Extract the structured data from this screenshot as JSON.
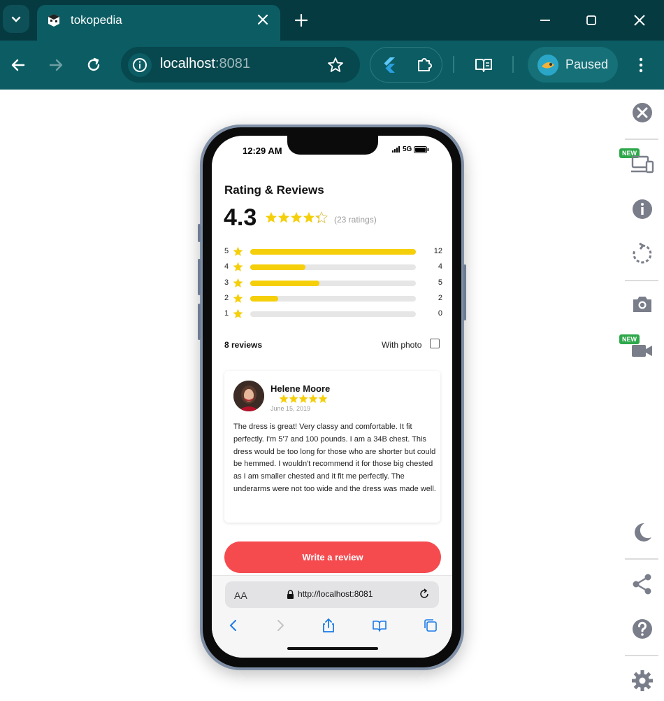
{
  "browser": {
    "tab_title": "tokopedia",
    "url_host": "localhost",
    "url_port": ":8081",
    "profile_label": "Paused"
  },
  "side_panel": {
    "new_badge_1": "NEW",
    "new_badge_2": "NEW"
  },
  "phone": {
    "status_time": "12:29 AM",
    "status_network": "5G",
    "title": "Rating & Reviews",
    "average": "4.3",
    "ratings_count": "(23 ratings)",
    "distribution": [
      {
        "stars": "5",
        "count": "12",
        "fraction": 1.0
      },
      {
        "stars": "4",
        "count": "4",
        "fraction": 0.333
      },
      {
        "stars": "3",
        "count": "5",
        "fraction": 0.417
      },
      {
        "stars": "2",
        "count": "2",
        "fraction": 0.167
      },
      {
        "stars": "1",
        "count": "0",
        "fraction": 0.0
      }
    ],
    "reviews_count": "8 reviews",
    "with_photo_label": "With photo",
    "review": {
      "name": "Helene Moore",
      "date": "June 15, 2019",
      "rating": 5,
      "text": "The dress is great! Very classy and comfortable. It fit perfectly. I'm 5'7 and 100 pounds. I am a 34B chest. This dress would be too long for those who are shorter but could be hemmed. I wouldn't recommend it for those big chested as I am smaller chested and it fit me perfectly. The underarms were not too wide and the dress was made well."
    },
    "write_review_label": "Write a review",
    "safari": {
      "aa_label": "AA",
      "url": "http://localhost:8081"
    }
  },
  "colors": {
    "star": "#f5cf0a",
    "accent_button": "#f54b4f",
    "chrome_dark": "#053a40",
    "chrome_toolbar": "#0b5d63"
  }
}
